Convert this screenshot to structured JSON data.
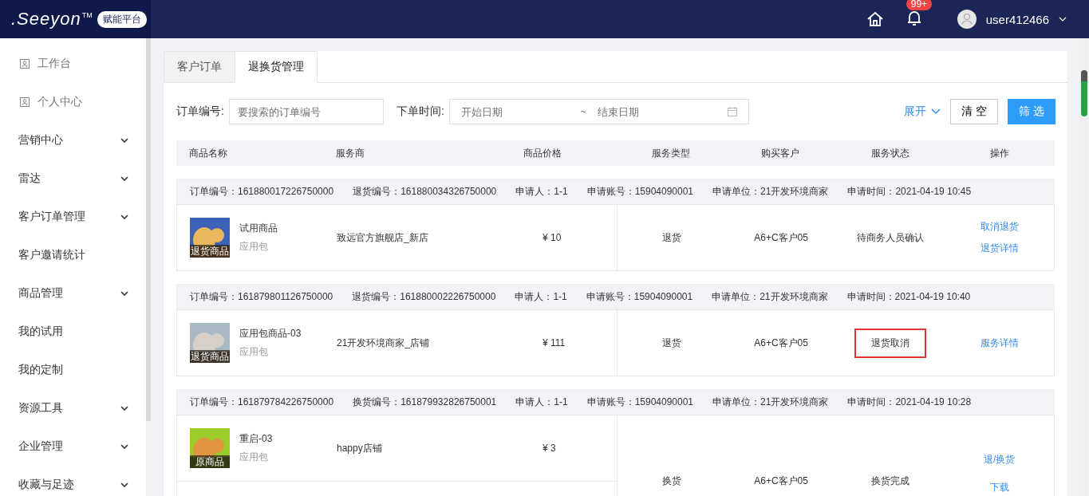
{
  "header": {
    "logo": ".Seeyon",
    "trademark": "TM",
    "platform_badge": "赋能平台",
    "notification_count": "99+",
    "username": "user412466"
  },
  "sidebar": {
    "items": [
      {
        "label": "工作台",
        "kind": "icon",
        "expandable": false
      },
      {
        "label": "个人中心",
        "kind": "icon",
        "expandable": false
      },
      {
        "label": "营销中心",
        "kind": "plain",
        "expandable": true
      },
      {
        "label": "雷达",
        "kind": "plain",
        "expandable": true
      },
      {
        "label": "客户订单管理",
        "kind": "plain",
        "expandable": true
      },
      {
        "label": "客户邀请统计",
        "kind": "plain",
        "expandable": false
      },
      {
        "label": "商品管理",
        "kind": "plain",
        "expandable": true
      },
      {
        "label": "我的试用",
        "kind": "plain",
        "expandable": false
      },
      {
        "label": "我的定制",
        "kind": "plain",
        "expandable": false
      },
      {
        "label": "资源工具",
        "kind": "plain",
        "expandable": true
      },
      {
        "label": "企业管理",
        "kind": "plain",
        "expandable": true
      },
      {
        "label": "收藏与足迹",
        "kind": "plain",
        "expandable": true
      }
    ]
  },
  "tabs": [
    {
      "label": "客户订单",
      "selected": false
    },
    {
      "label": "退换货管理",
      "selected": true
    }
  ],
  "filters": {
    "order_no_label": "订单编号:",
    "order_no_placeholder": "要搜索的订单编号",
    "time_label": "下单时间:",
    "start_placeholder": "开始日期",
    "separator": "~",
    "end_placeholder": "结束日期",
    "expand": "展开",
    "clear": "清 空",
    "filter": "筛 选"
  },
  "table": {
    "columns": [
      "商品名称",
      "服务商",
      "商品价格",
      "服务类型",
      "购买客户",
      "服务状态",
      "操作"
    ],
    "groups": [
      {
        "kind": "single",
        "meta": [
          "订单编号：161880017226750000",
          "退货编号：161880034326750000",
          "申请人：1-1",
          "申请账号：15904090001",
          "申请单位：21开发环境商家",
          "申请时间：2021-04-19 10:45"
        ],
        "product": {
          "name": "试用商品",
          "type": "应用包",
          "tag": "退货商品",
          "provider": "致远官方旗舰店_新店",
          "price": "¥ 10"
        },
        "service_type": "退货",
        "customer": "A6+C客户05",
        "status": "待商务人员确认",
        "highlighted": false,
        "actions": [
          "取消退货",
          "退货详情"
        ]
      },
      {
        "kind": "single",
        "meta": [
          "订单编号：161879801126750000",
          "退货编号：161880002226750000",
          "申请人：1-1",
          "申请账号：15904090001",
          "申请单位：21开发环境商家",
          "申请时间：2021-04-19 10:40"
        ],
        "product": {
          "name": "应用包商品-03",
          "type": "应用包",
          "tag": "退货商品",
          "provider": "21开发环境商家_店铺",
          "price": "¥ 111"
        },
        "service_type": "退货",
        "customer": "A6+C客户05",
        "status": "退货取消",
        "highlighted": true,
        "actions": [
          "服务详情"
        ]
      },
      {
        "kind": "exchange",
        "meta": [
          "订单编号：161879784226750000",
          "换货编号：161879932826750001",
          "申请人：1-1",
          "申请账号：15904090001",
          "申请单位：21开发环境商家",
          "申请时间：2021-04-19 10:28"
        ],
        "product": {
          "name": "重启-03",
          "type": "应用包",
          "tag": "原商品",
          "provider": "happy店铺",
          "price": "¥ 3"
        },
        "service_type": "换货",
        "customer": "A6+C客户05",
        "status": "换货完成",
        "highlighted": false,
        "actions": [
          "退/换货",
          "下载"
        ]
      }
    ]
  }
}
